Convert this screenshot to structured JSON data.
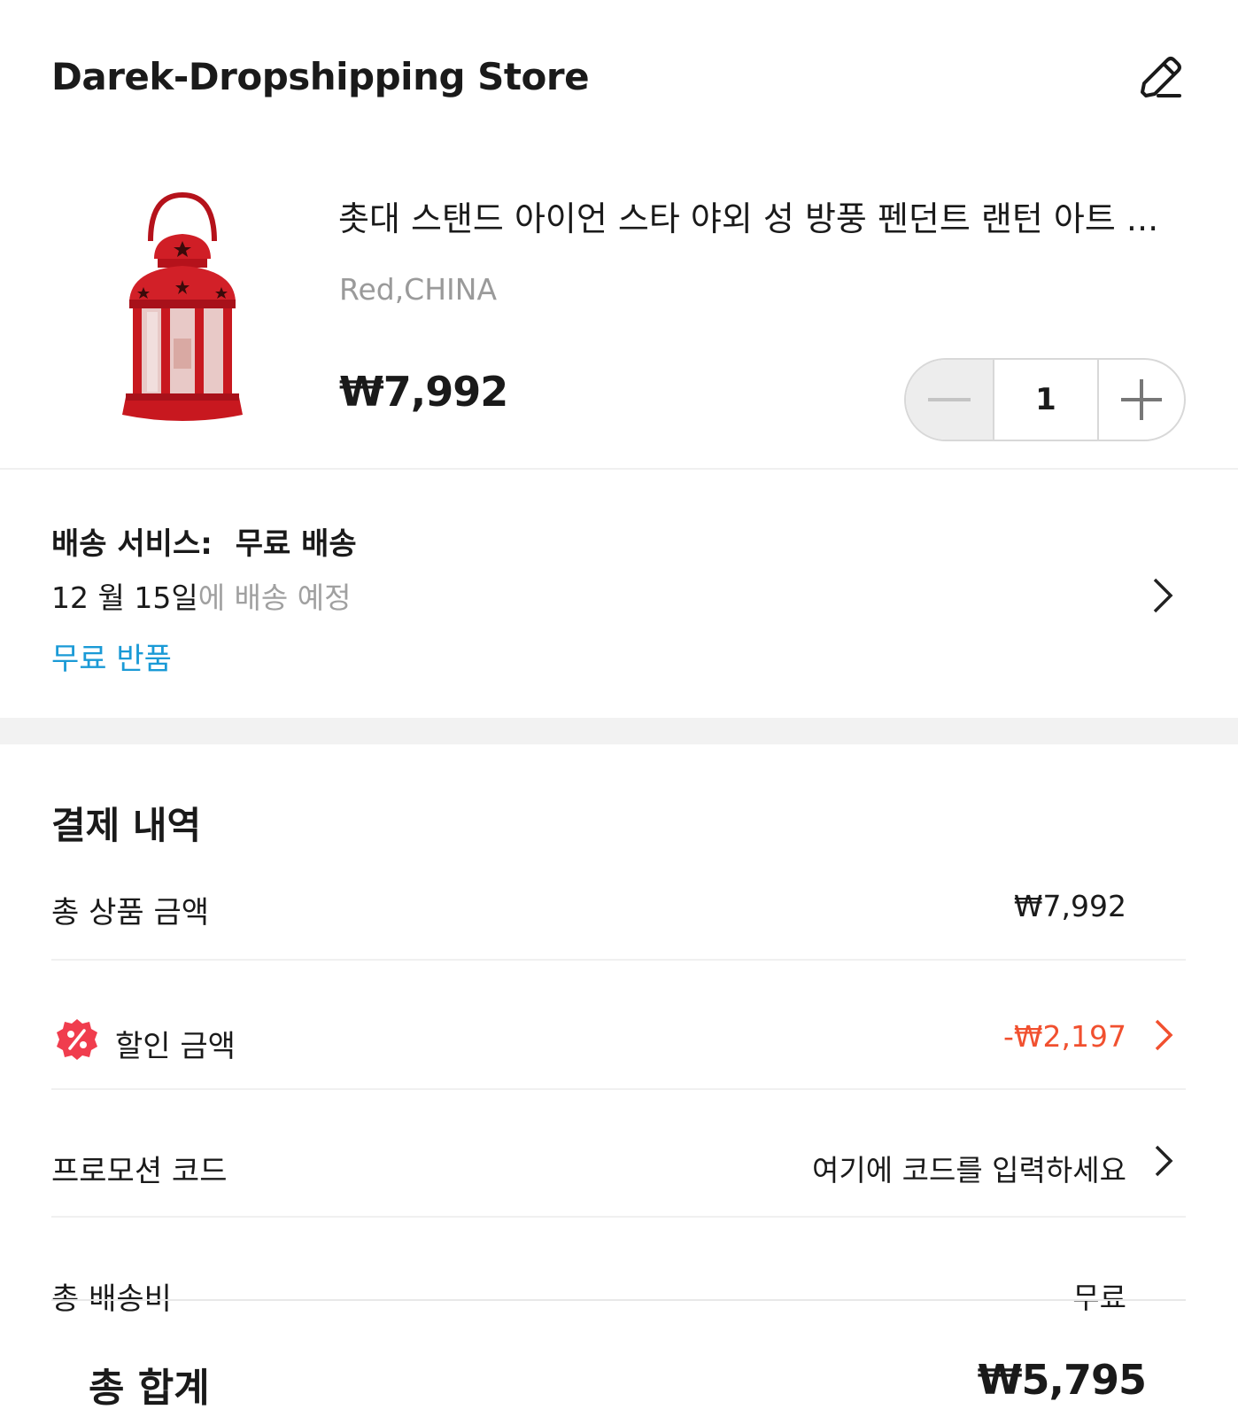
{
  "store": {
    "name": "Darek-Dropshipping Store",
    "edit_icon": "pencil-icon"
  },
  "product": {
    "title": "촛대 스탠드 아이언 스타 야외 성 방풍 펜던트 랜턴 아트 ...",
    "variant": "Red,CHINA",
    "price": "₩7,992",
    "quantity": "1",
    "image_icon": "red-lantern-image"
  },
  "shipping": {
    "service_label": "배송 서비스:",
    "service_value": "무료 배송",
    "date": "12 월 15일",
    "date_suffix": "에 배송 예정",
    "free_return": "무료 반품"
  },
  "payment": {
    "title": "결제 내역",
    "subtotal_label": "총 상품 금액",
    "subtotal_value": "₩7,992",
    "discount_label": "할인 금액",
    "discount_value": "-₩2,197",
    "promo_label": "프로모션 코드",
    "promo_placeholder": "여기에 코드를 입력하세요",
    "shipping_label": "총 배송비",
    "shipping_value": "무료",
    "total_label": "총 합계",
    "total_value": "₩5,795"
  },
  "colors": {
    "accent_blue": "#1a9ad6",
    "discount_red": "#f1502f",
    "badge_red": "#f03d4e"
  }
}
